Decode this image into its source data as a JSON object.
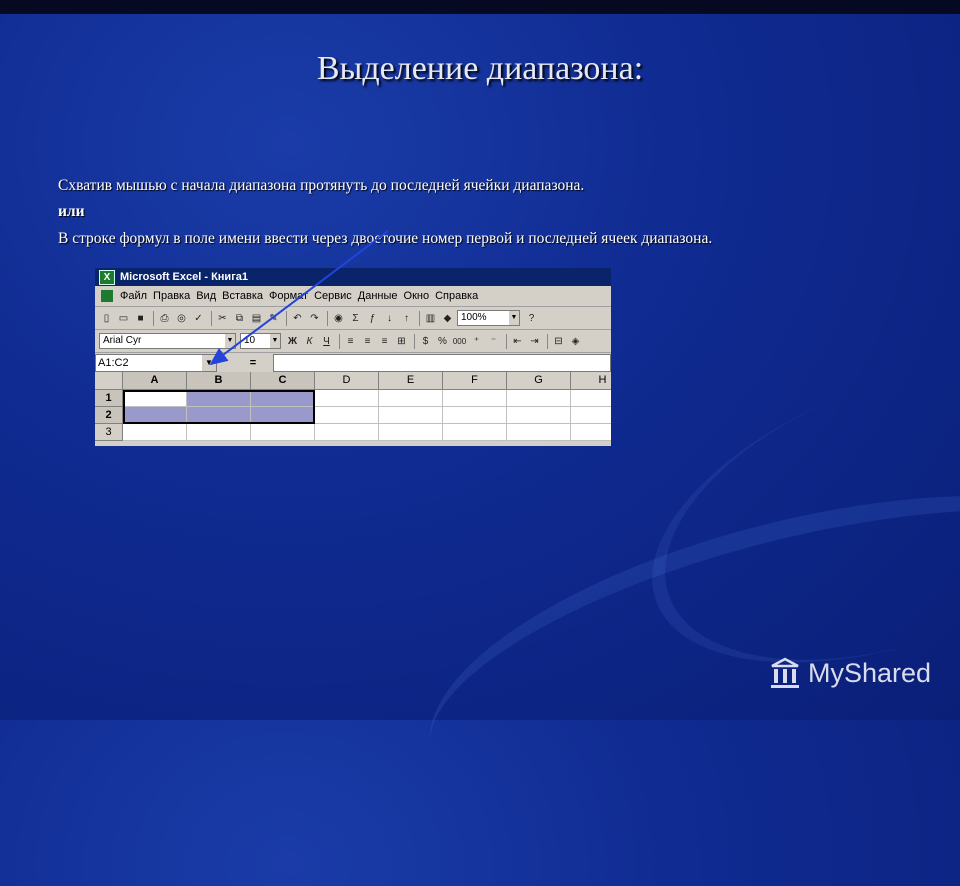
{
  "slide": {
    "title": "Выделение диапазона:",
    "line1": "Схватив мышью с начала диапазона протянуть до последней ячейки диапазона.",
    "line2": "или",
    "line3": "В строке формул в поле имени ввести через двоеточие номер первой и последней ячеек диапазона."
  },
  "excel": {
    "window_title": "Microsoft Excel - Книга1",
    "menu": [
      "Файл",
      "Правка",
      "Вид",
      "Вставка",
      "Формат",
      "Сервис",
      "Данные",
      "Окно",
      "Справка"
    ],
    "zoom": "100%",
    "font_name": "Arial Cyr",
    "font_size": "10",
    "name_box": "A1:C2",
    "formula_eq": "=",
    "columns": [
      "A",
      "B",
      "C",
      "D",
      "E",
      "F",
      "G",
      "H"
    ],
    "rows": [
      "1",
      "2",
      "3"
    ],
    "selected_range": "A1:C2"
  },
  "watermark": {
    "text": "MyShared"
  },
  "colors": {
    "selection": "#9999cc",
    "titlebar": "#0a246a",
    "arrow": "#2244dd"
  }
}
